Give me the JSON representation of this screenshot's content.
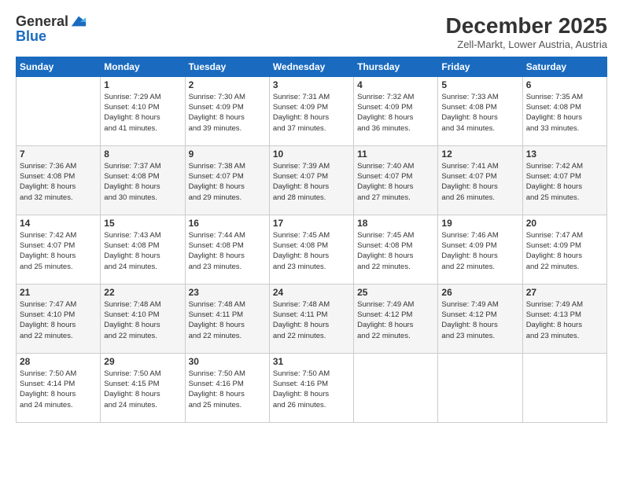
{
  "logo": {
    "general": "General",
    "blue": "Blue"
  },
  "header": {
    "month": "December 2025",
    "location": "Zell-Markt, Lower Austria, Austria"
  },
  "weekdays": [
    "Sunday",
    "Monday",
    "Tuesday",
    "Wednesday",
    "Thursday",
    "Friday",
    "Saturday"
  ],
  "weeks": [
    [
      {
        "day": "",
        "info": ""
      },
      {
        "day": "1",
        "info": "Sunrise: 7:29 AM\nSunset: 4:10 PM\nDaylight: 8 hours\nand 41 minutes."
      },
      {
        "day": "2",
        "info": "Sunrise: 7:30 AM\nSunset: 4:09 PM\nDaylight: 8 hours\nand 39 minutes."
      },
      {
        "day": "3",
        "info": "Sunrise: 7:31 AM\nSunset: 4:09 PM\nDaylight: 8 hours\nand 37 minutes."
      },
      {
        "day": "4",
        "info": "Sunrise: 7:32 AM\nSunset: 4:09 PM\nDaylight: 8 hours\nand 36 minutes."
      },
      {
        "day": "5",
        "info": "Sunrise: 7:33 AM\nSunset: 4:08 PM\nDaylight: 8 hours\nand 34 minutes."
      },
      {
        "day": "6",
        "info": "Sunrise: 7:35 AM\nSunset: 4:08 PM\nDaylight: 8 hours\nand 33 minutes."
      }
    ],
    [
      {
        "day": "7",
        "info": "Sunrise: 7:36 AM\nSunset: 4:08 PM\nDaylight: 8 hours\nand 32 minutes."
      },
      {
        "day": "8",
        "info": "Sunrise: 7:37 AM\nSunset: 4:08 PM\nDaylight: 8 hours\nand 30 minutes."
      },
      {
        "day": "9",
        "info": "Sunrise: 7:38 AM\nSunset: 4:07 PM\nDaylight: 8 hours\nand 29 minutes."
      },
      {
        "day": "10",
        "info": "Sunrise: 7:39 AM\nSunset: 4:07 PM\nDaylight: 8 hours\nand 28 minutes."
      },
      {
        "day": "11",
        "info": "Sunrise: 7:40 AM\nSunset: 4:07 PM\nDaylight: 8 hours\nand 27 minutes."
      },
      {
        "day": "12",
        "info": "Sunrise: 7:41 AM\nSunset: 4:07 PM\nDaylight: 8 hours\nand 26 minutes."
      },
      {
        "day": "13",
        "info": "Sunrise: 7:42 AM\nSunset: 4:07 PM\nDaylight: 8 hours\nand 25 minutes."
      }
    ],
    [
      {
        "day": "14",
        "info": "Sunrise: 7:42 AM\nSunset: 4:07 PM\nDaylight: 8 hours\nand 25 minutes."
      },
      {
        "day": "15",
        "info": "Sunrise: 7:43 AM\nSunset: 4:08 PM\nDaylight: 8 hours\nand 24 minutes."
      },
      {
        "day": "16",
        "info": "Sunrise: 7:44 AM\nSunset: 4:08 PM\nDaylight: 8 hours\nand 23 minutes."
      },
      {
        "day": "17",
        "info": "Sunrise: 7:45 AM\nSunset: 4:08 PM\nDaylight: 8 hours\nand 23 minutes."
      },
      {
        "day": "18",
        "info": "Sunrise: 7:45 AM\nSunset: 4:08 PM\nDaylight: 8 hours\nand 22 minutes."
      },
      {
        "day": "19",
        "info": "Sunrise: 7:46 AM\nSunset: 4:09 PM\nDaylight: 8 hours\nand 22 minutes."
      },
      {
        "day": "20",
        "info": "Sunrise: 7:47 AM\nSunset: 4:09 PM\nDaylight: 8 hours\nand 22 minutes."
      }
    ],
    [
      {
        "day": "21",
        "info": "Sunrise: 7:47 AM\nSunset: 4:10 PM\nDaylight: 8 hours\nand 22 minutes."
      },
      {
        "day": "22",
        "info": "Sunrise: 7:48 AM\nSunset: 4:10 PM\nDaylight: 8 hours\nand 22 minutes."
      },
      {
        "day": "23",
        "info": "Sunrise: 7:48 AM\nSunset: 4:11 PM\nDaylight: 8 hours\nand 22 minutes."
      },
      {
        "day": "24",
        "info": "Sunrise: 7:48 AM\nSunset: 4:11 PM\nDaylight: 8 hours\nand 22 minutes."
      },
      {
        "day": "25",
        "info": "Sunrise: 7:49 AM\nSunset: 4:12 PM\nDaylight: 8 hours\nand 22 minutes."
      },
      {
        "day": "26",
        "info": "Sunrise: 7:49 AM\nSunset: 4:12 PM\nDaylight: 8 hours\nand 23 minutes."
      },
      {
        "day": "27",
        "info": "Sunrise: 7:49 AM\nSunset: 4:13 PM\nDaylight: 8 hours\nand 23 minutes."
      }
    ],
    [
      {
        "day": "28",
        "info": "Sunrise: 7:50 AM\nSunset: 4:14 PM\nDaylight: 8 hours\nand 24 minutes."
      },
      {
        "day": "29",
        "info": "Sunrise: 7:50 AM\nSunset: 4:15 PM\nDaylight: 8 hours\nand 24 minutes."
      },
      {
        "day": "30",
        "info": "Sunrise: 7:50 AM\nSunset: 4:16 PM\nDaylight: 8 hours\nand 25 minutes."
      },
      {
        "day": "31",
        "info": "Sunrise: 7:50 AM\nSunset: 4:16 PM\nDaylight: 8 hours\nand 26 minutes."
      },
      {
        "day": "",
        "info": ""
      },
      {
        "day": "",
        "info": ""
      },
      {
        "day": "",
        "info": ""
      }
    ]
  ]
}
